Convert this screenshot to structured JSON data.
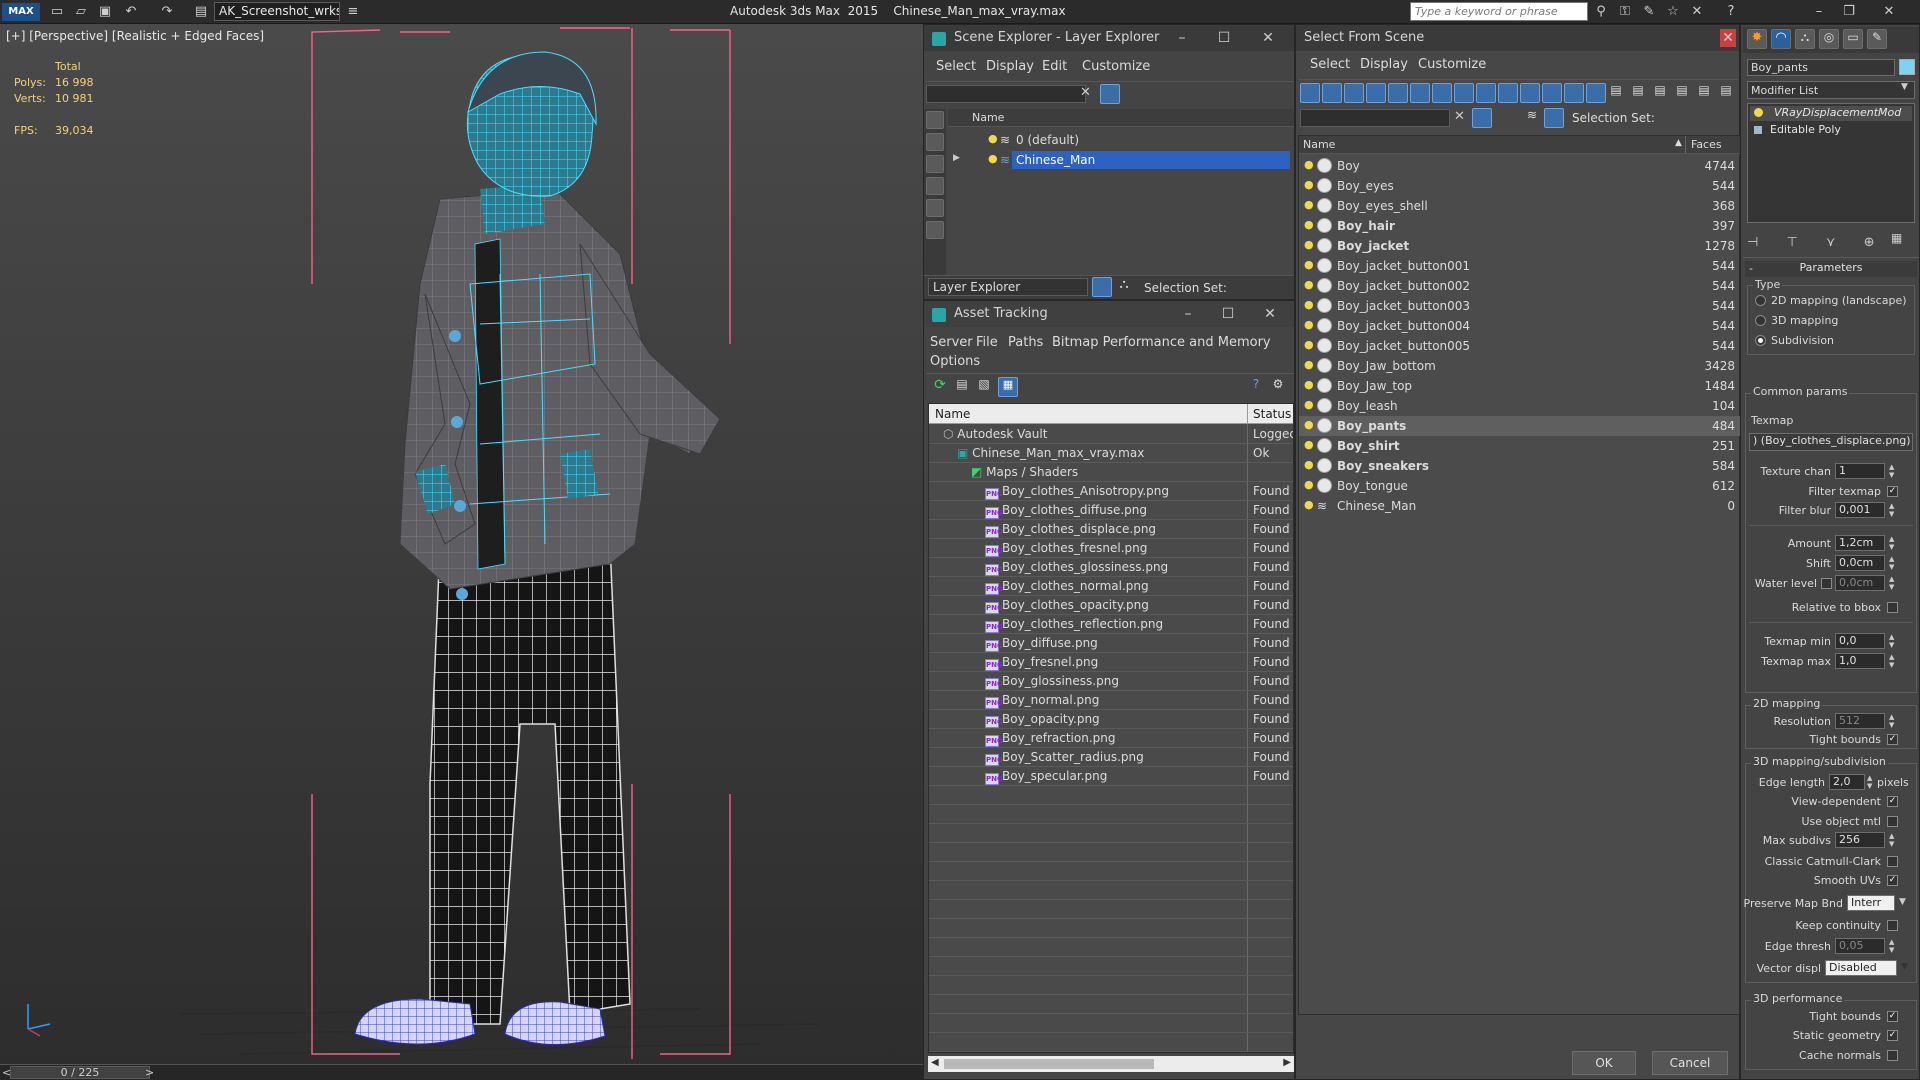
{
  "app": {
    "title": "Autodesk 3ds Max  2015    Chinese_Man_max_vray.max",
    "workspace": "AK_Screenshot_wrksp",
    "keyword_placeholder": "Type a keyword or phrase",
    "logo": "MAX"
  },
  "viewport": {
    "label": "[+] [Perspective] [Realistic + Edged Faces]",
    "stats": {
      "total_label": "Total",
      "polys_label": "Polys:",
      "polys": "16 998",
      "verts_label": "Verts:",
      "verts": "10 981",
      "fps_label": "FPS:",
      "fps": "39,034"
    },
    "time": "0 / 225"
  },
  "layer_explorer": {
    "title": "Scene Explorer - Layer Explorer",
    "menu": [
      "Select",
      "Display",
      "Edit",
      "Customize"
    ],
    "col_name": "Name",
    "rows": [
      {
        "name": "0 (default)"
      },
      {
        "name": "Chinese_Man",
        "selected": true
      }
    ],
    "footer_mode": "Layer Explorer",
    "selection_set": "Selection Set:"
  },
  "asset_tracking": {
    "title": "Asset Tracking",
    "menu": [
      "Server",
      "File",
      "Paths",
      "Bitmap Performance and Memory",
      "Options"
    ],
    "col_name": "Name",
    "col_status": "Status",
    "rows": [
      {
        "name": "Autodesk Vault",
        "status": "Logged",
        "indent": 0,
        "icon": "vault"
      },
      {
        "name": "Chinese_Man_max_vray.max",
        "status": "Ok",
        "indent": 1,
        "icon": "max"
      },
      {
        "name": "Maps / Shaders",
        "status": "",
        "indent": 2,
        "icon": "maps"
      },
      {
        "name": "Boy_clothes_Anisotropy.png",
        "status": "Found",
        "indent": 3,
        "icon": "png"
      },
      {
        "name": "Boy_clothes_diffuse.png",
        "status": "Found",
        "indent": 3,
        "icon": "png"
      },
      {
        "name": "Boy_clothes_displace.png",
        "status": "Found",
        "indent": 3,
        "icon": "png"
      },
      {
        "name": "Boy_clothes_fresnel.png",
        "status": "Found",
        "indent": 3,
        "icon": "png"
      },
      {
        "name": "Boy_clothes_glossiness.png",
        "status": "Found",
        "indent": 3,
        "icon": "png"
      },
      {
        "name": "Boy_clothes_normal.png",
        "status": "Found",
        "indent": 3,
        "icon": "png"
      },
      {
        "name": "Boy_clothes_opacity.png",
        "status": "Found",
        "indent": 3,
        "icon": "png"
      },
      {
        "name": "Boy_clothes_reflection.png",
        "status": "Found",
        "indent": 3,
        "icon": "png"
      },
      {
        "name": "Boy_diffuse.png",
        "status": "Found",
        "indent": 3,
        "icon": "png"
      },
      {
        "name": "Boy_fresnel.png",
        "status": "Found",
        "indent": 3,
        "icon": "png"
      },
      {
        "name": "Boy_glossiness.png",
        "status": "Found",
        "indent": 3,
        "icon": "png"
      },
      {
        "name": "Boy_normal.png",
        "status": "Found",
        "indent": 3,
        "icon": "png"
      },
      {
        "name": "Boy_opacity.png",
        "status": "Found",
        "indent": 3,
        "icon": "png"
      },
      {
        "name": "Boy_refraction.png",
        "status": "Found",
        "indent": 3,
        "icon": "png"
      },
      {
        "name": "Boy_Scatter_radius.png",
        "status": "Found",
        "indent": 3,
        "icon": "png"
      },
      {
        "name": "Boy_specular.png",
        "status": "Found",
        "indent": 3,
        "icon": "png"
      }
    ]
  },
  "select_from_scene": {
    "title": "Select From Scene",
    "menu": [
      "Select",
      "Display",
      "Customize"
    ],
    "selection_set": "Selection Set:",
    "col_name": "Name",
    "col_faces": "Faces",
    "rows": [
      {
        "name": "Boy",
        "faces": "4744",
        "bold": false
      },
      {
        "name": "Boy_eyes",
        "faces": "544",
        "bold": false
      },
      {
        "name": "Boy_eyes_shell",
        "faces": "368",
        "bold": false
      },
      {
        "name": "Boy_hair",
        "faces": "397",
        "bold": true
      },
      {
        "name": "Boy_jacket",
        "faces": "1278",
        "bold": true
      },
      {
        "name": "Boy_jacket_button001",
        "faces": "544",
        "bold": false
      },
      {
        "name": "Boy_jacket_button002",
        "faces": "544",
        "bold": false
      },
      {
        "name": "Boy_jacket_button003",
        "faces": "544",
        "bold": false
      },
      {
        "name": "Boy_jacket_button004",
        "faces": "544",
        "bold": false
      },
      {
        "name": "Boy_jacket_button005",
        "faces": "544",
        "bold": false
      },
      {
        "name": "Boy_Jaw_bottom",
        "faces": "3428",
        "bold": false
      },
      {
        "name": "Boy_Jaw_top",
        "faces": "1484",
        "bold": false
      },
      {
        "name": "Boy_leash",
        "faces": "104",
        "bold": false
      },
      {
        "name": "Boy_pants",
        "faces": "484",
        "bold": true,
        "selected": true
      },
      {
        "name": "Boy_shirt",
        "faces": "251",
        "bold": true
      },
      {
        "name": "Boy_sneakers",
        "faces": "584",
        "bold": true
      },
      {
        "name": "Boy_tongue",
        "faces": "612",
        "bold": false
      },
      {
        "name": "Chinese_Man",
        "faces": "0",
        "bold": false,
        "layer": true
      }
    ],
    "ok": "OK",
    "cancel": "Cancel"
  },
  "command_panel": {
    "object_name": "Boy_pants",
    "modifier_list": "Modifier List",
    "stack": [
      "VRayDisplacementMod",
      "Editable Poly"
    ],
    "params_title": "Parameters",
    "type_label": "Type",
    "type_options": [
      "2D mapping (landscape)",
      "3D mapping",
      "Subdivision"
    ],
    "type_selected": 2,
    "common_params": "Common params",
    "texmap_label": "Texmap",
    "texmap": ") (Boy_clothes_displace.png)",
    "texture_chan_label": "Texture chan",
    "texture_chan": "1",
    "filter_texmap_label": "Filter texmap",
    "filter_blur_label": "Filter blur",
    "filter_blur": "0,001",
    "amount_label": "Amount",
    "amount": "1,2cm",
    "shift_label": "Shift",
    "shift": "0,0cm",
    "water_level_label": "Water level",
    "water_level": "0,0cm",
    "relative_bbox_label": "Relative to bbox",
    "texmap_min_label": "Texmap min",
    "texmap_min": "0,0",
    "texmap_max_label": "Texmap max",
    "texmap_max": "1,0",
    "mapping2d_title": "2D mapping",
    "resolution_label": "Resolution",
    "resolution": "512",
    "tight_bounds_label": "Tight bounds",
    "mapping3d_title": "3D mapping/subdivision",
    "edge_length_label": "Edge length",
    "edge_length": "2,0",
    "pixels_label": "pixels",
    "view_dependent_label": "View-dependent",
    "use_object_mtl_label": "Use object mtl",
    "max_subdivs_label": "Max subdivs",
    "max_subdivs": "256",
    "classic_cc_label": "Classic Catmull-Clark",
    "smooth_uvs_label": "Smooth UVs",
    "preserve_map_label": "Preserve Map Bnd",
    "preserve_map": "Interr",
    "keep_continuity_label": "Keep continuity",
    "edge_thresh_label": "Edge thresh",
    "edge_thresh": "0,05",
    "vector_displ_label": "Vector displ",
    "vector_displ": "Disabled",
    "perf_title": "3D performance",
    "perf_tight_label": "Tight bounds",
    "static_geo_label": "Static geometry",
    "cache_normals_label": "Cache normals"
  },
  "colors": {
    "selection_blue": "#2d62c2",
    "wire_cyan": "#38d4f2",
    "bbox_pink": "#ff5d8a"
  }
}
